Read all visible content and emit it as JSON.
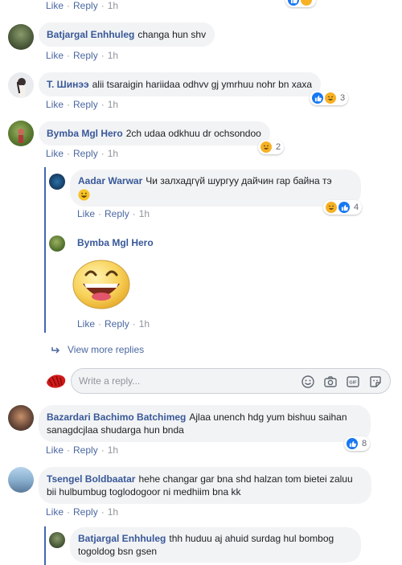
{
  "actions": {
    "like": "Like",
    "reply": "Reply"
  },
  "comments": [
    {
      "author": "",
      "text": "",
      "time": "1h"
    },
    {
      "author": "Batjargal Enhhuleg",
      "text": "changa hun shv",
      "time": "1h"
    },
    {
      "author": "T. Шинээ",
      "text": "alii tsaraigin hariidaa odhvv gj ymrhuu nohr bn xaxa",
      "time": "1h",
      "reactions": 3
    },
    {
      "author": "Bymba Mgl Hero",
      "text": "2ch udaa odkhuu dr ochsondoo",
      "time": "1h",
      "reactions": 2
    },
    {
      "author": "Bazardari Bachimo Batchimeg",
      "text": "Ajlaa unench hdg yum bishuu saihan sanagdcjlaa shudarga hun bnda",
      "time": "1h",
      "reactions": 8
    },
    {
      "author": "Tsengel Boldbaatar",
      "text": "hehe changar gar bna shd halzan tom bietei zaluu bii hulbumbug toglodogoor ni medhiim bna kk",
      "time": "1h"
    }
  ],
  "replies": [
    {
      "author": "Aadar Warwar",
      "text": "Чи залхадгүй шургуу дайчин гар байна тэ",
      "time": "1h",
      "reactions": 4
    },
    {
      "author": "Bymba Mgl Hero",
      "text": "",
      "time": "1h"
    },
    {
      "author": "Batjargal Enhhuleg",
      "text": "thh huduu aj ahuid surdag hul bombog togoldog bsn gsen"
    }
  ],
  "view_more": "View more replies",
  "reply_input": {
    "placeholder": "Write a reply..."
  },
  "colors": {
    "link": "#385898",
    "meta_link": "#4b67a1",
    "bubble": "#f2f3f5",
    "thread": "#4267b2",
    "like_blue": "#1877f2",
    "haha_yellow": "#f7b125"
  },
  "icons": [
    "smiley-icon",
    "camera-icon",
    "gif-icon",
    "sticker-icon",
    "view-more-arrow-icon",
    "like-reaction-icon",
    "haha-reaction-icon"
  ]
}
